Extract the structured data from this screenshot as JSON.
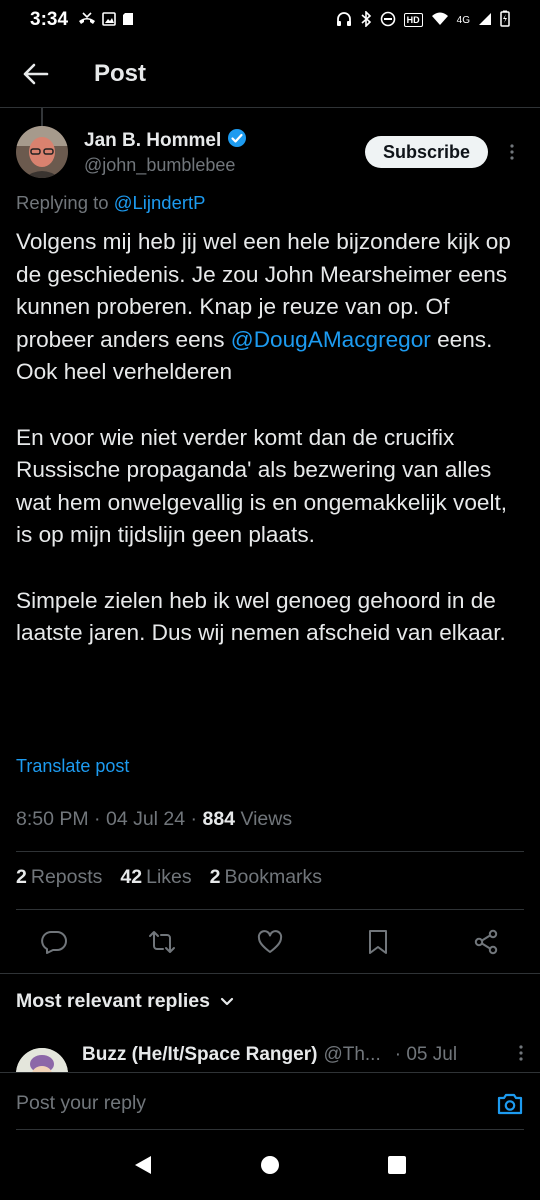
{
  "status_bar": {
    "time": "3:34",
    "network": "4G",
    "hd": "HD"
  },
  "header": {
    "title": "Post"
  },
  "post": {
    "author_name": "Jan B. Hommel",
    "author_handle": "@john_bumblebee",
    "subscribe_label": "Subscribe",
    "replying_prefix": "Replying to",
    "replying_to": "@LijndertP",
    "paragraph1_a": "Volgens mij heb jij wel een hele bijzondere kijk op de geschiedenis. Je zou John Mearsheimer eens kunnen proberen. Knap je reuze van op. Of probeer anders eens",
    "paragraph1_mention": "@DougAMacgregor",
    "paragraph1_b": "eens. Ook heel verhelderen",
    "paragraph2": "En voor wie niet verder komt dan de crucifix Russische propaganda' als bezwering van alles wat hem onwelgevallig is en ongemakkelijk voelt, is op mijn tijdslijn geen plaats.",
    "paragraph3": "Simpele zielen heb ik wel genoeg gehoord in de laatste jaren. Dus wij nemen afscheid van elkaar.",
    "translate_label": "Translate post",
    "time": "8:50 PM",
    "date": "04 Jul 24",
    "views_count": "884",
    "views_label": "Views",
    "reposts_count": "2",
    "reposts_label": "Reposts",
    "likes_count": "42",
    "likes_label": "Likes",
    "bookmarks_count": "2",
    "bookmarks_label": "Bookmarks"
  },
  "replies": {
    "sort_label": "Most relevant replies",
    "first_reply": {
      "name": "Buzz (He/It/Space Ranger)",
      "handle": "@Th...",
      "date": "· 05 Jul"
    }
  },
  "composer": {
    "placeholder": "Post your reply"
  },
  "colors": {
    "accent": "#1d9bf0",
    "background": "#000000",
    "muted": "#71767b",
    "text": "#e7e9ea"
  }
}
